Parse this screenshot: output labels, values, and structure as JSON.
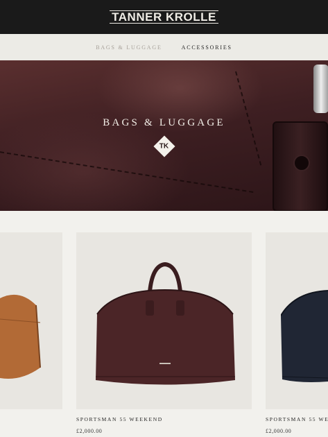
{
  "header": {
    "logo": "TANNER KROLLE"
  },
  "nav": {
    "items": [
      {
        "label": "BAGS & LUGGAGE",
        "state": "inactive"
      },
      {
        "label": "ACCESSORIES",
        "state": "active"
      }
    ]
  },
  "hero": {
    "title": "BAGS & LUGGAGE",
    "monogram": "TK"
  },
  "products": [
    {
      "name": "",
      "price": "",
      "color": "tan"
    },
    {
      "name": "SPORTSMAN 55 WEEKEND",
      "price": "£2,000.00",
      "color": "burgundy"
    },
    {
      "name": "SPORTSMAN 55 WEE",
      "price": "£2,000.00",
      "color": "navy"
    }
  ],
  "colors": {
    "header_bg": "#1a1a1a",
    "nav_bg": "#ecebe6",
    "page_bg": "#f2f1ed",
    "card_bg": "#e8e6e1"
  }
}
